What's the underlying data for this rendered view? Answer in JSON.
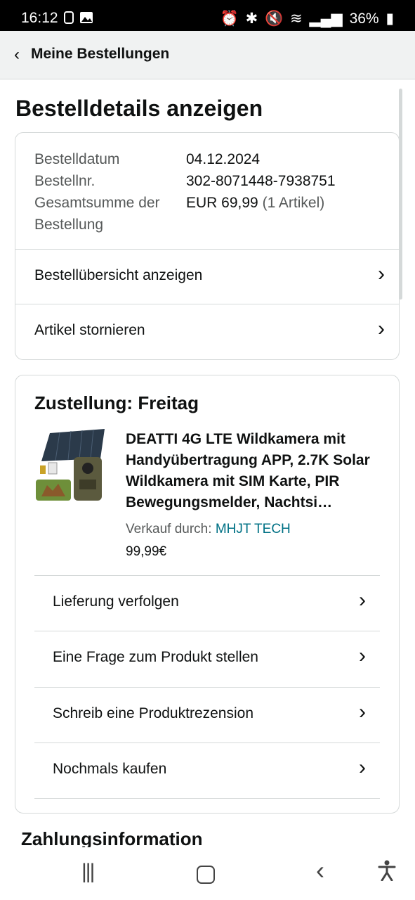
{
  "status_bar": {
    "time": "16:12",
    "battery": "36%"
  },
  "header": {
    "back_label": "Meine Bestellungen"
  },
  "page_title": "Bestelldetails anzeigen",
  "order_info": {
    "rows": [
      {
        "label": "Bestelldatum",
        "value": "04.12.2024"
      },
      {
        "label": "Bestellnr.",
        "value": "302-8071448-7938751"
      },
      {
        "label": "Gesamtsumme der Bestellung",
        "value": "EUR 69,99",
        "value_extra": "(1 Artikel)"
      }
    ],
    "links": [
      {
        "label": "Bestellübersicht anzeigen"
      },
      {
        "label": "Artikel stornieren"
      }
    ]
  },
  "delivery": {
    "title": "Zustellung: Freitag",
    "product": {
      "title": "DEATTI 4G LTE Wildkamera mit Handyübertragung APP, 2.7K Solar Wildkamera mit SIM Karte, PIR Bewegungsmelder, Nachtsi…",
      "seller_prefix": "Verkauf durch:",
      "seller_name": "MHJT TECH",
      "price": "99,99€"
    },
    "actions": [
      {
        "label": "Lieferung verfolgen"
      },
      {
        "label": "Eine Frage zum Produkt stellen"
      },
      {
        "label": "Schreib eine Produktrezension"
      },
      {
        "label": "Nochmals kaufen"
      }
    ]
  },
  "payment_section_title": "Zahlungsinformation"
}
